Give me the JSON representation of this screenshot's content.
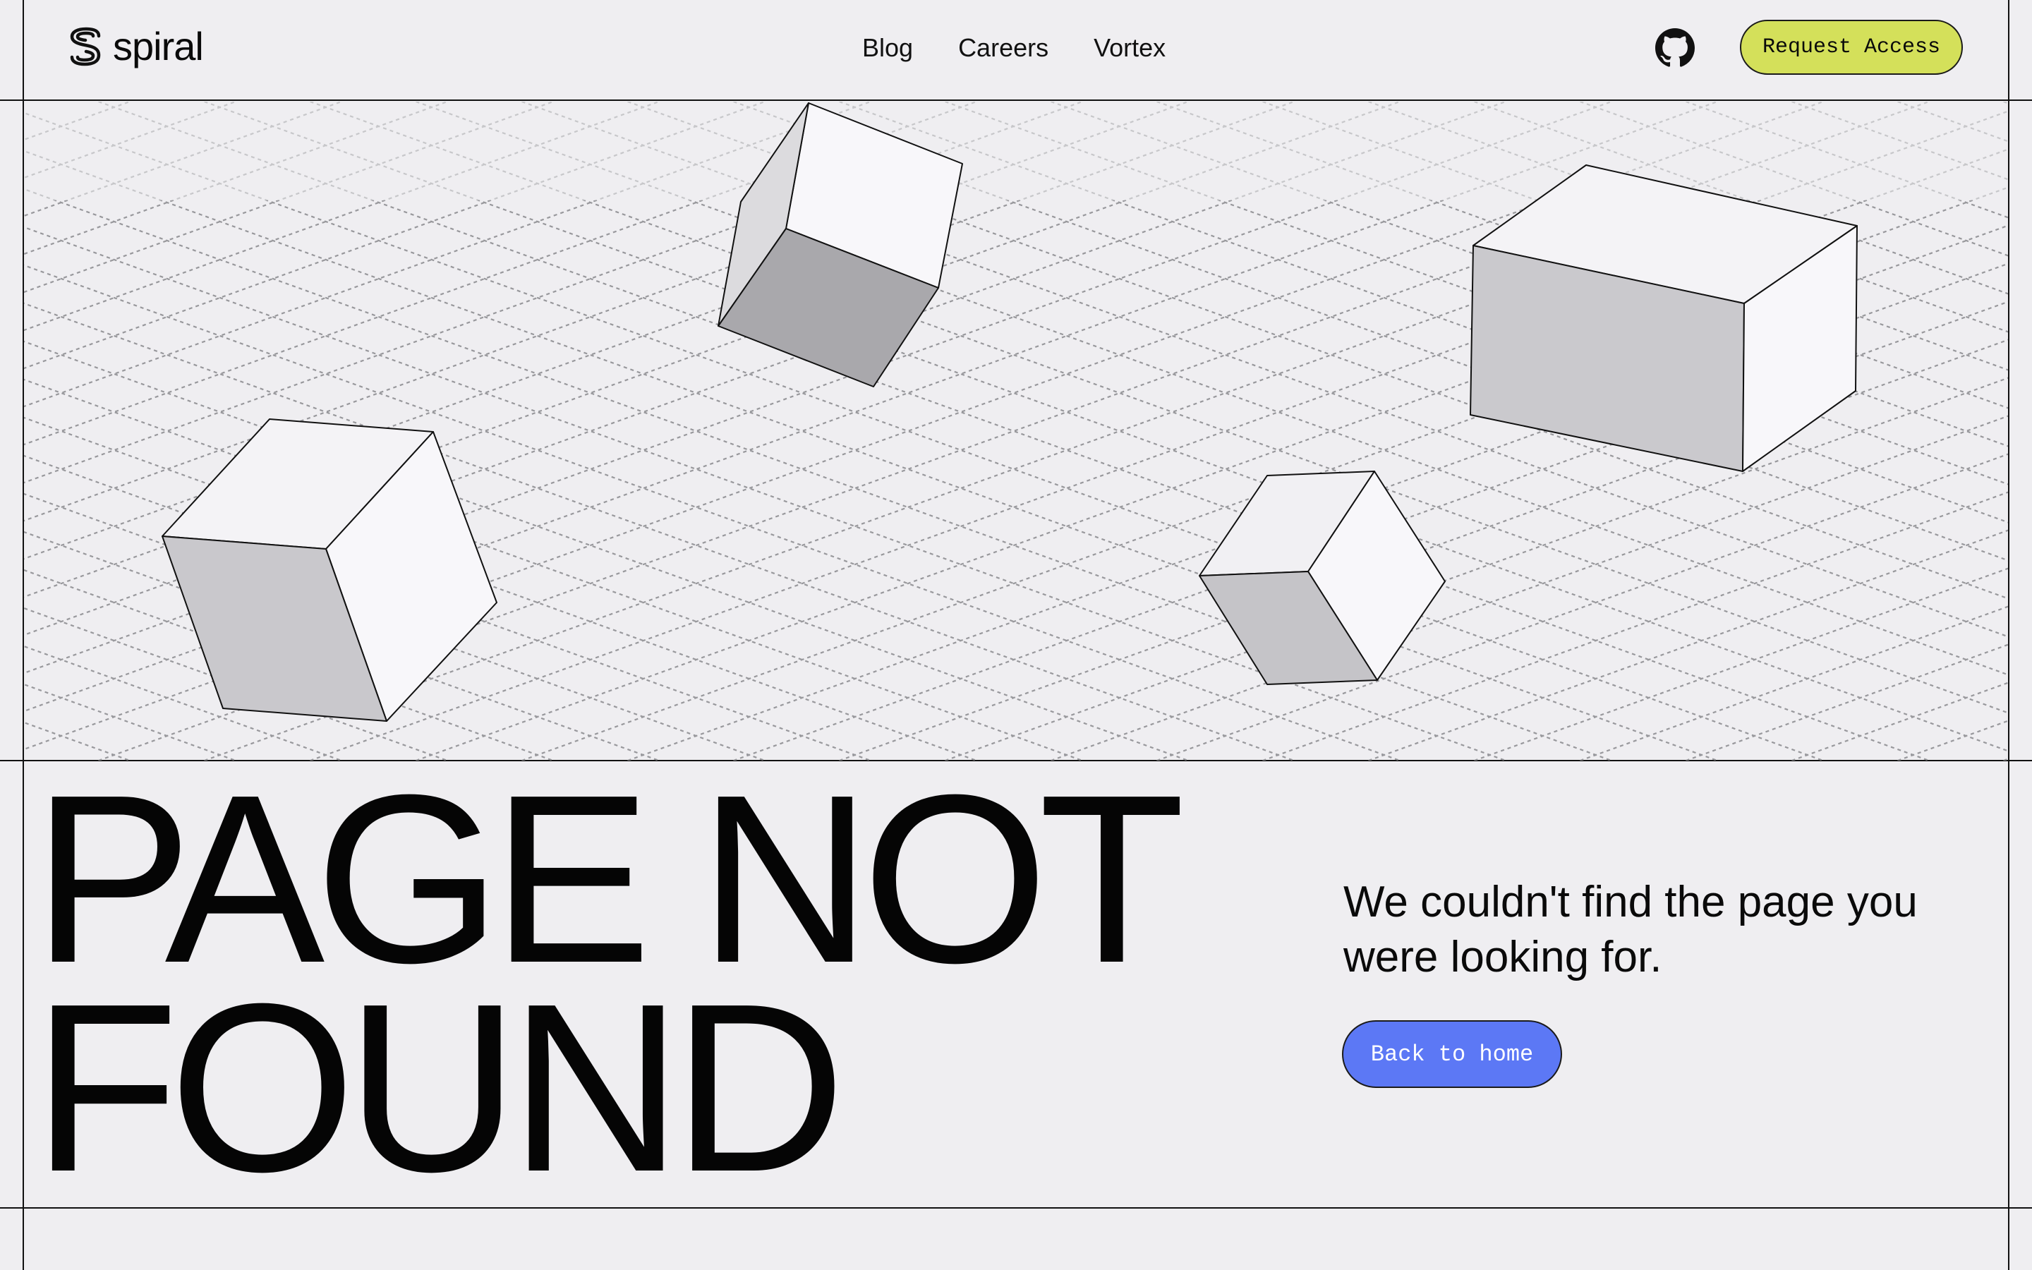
{
  "header": {
    "logo_text": "spiral",
    "nav": [
      {
        "label": "Blog"
      },
      {
        "label": "Careers"
      },
      {
        "label": "Vortex"
      }
    ],
    "github_icon": "github-icon",
    "cta_label": "Request Access"
  },
  "main": {
    "headline_line1": "PAGE NOT",
    "headline_line2": "FOUND",
    "message": "We couldn't find the page you were looking for.",
    "back_label": "Back to home"
  },
  "colors": {
    "background": "#efeef1",
    "cta_accent": "#d4e05a",
    "button_blue": "#5c78f5",
    "line": "#111111"
  },
  "illustration": {
    "description_icon": "isometric-cubes-grid-illustration"
  }
}
